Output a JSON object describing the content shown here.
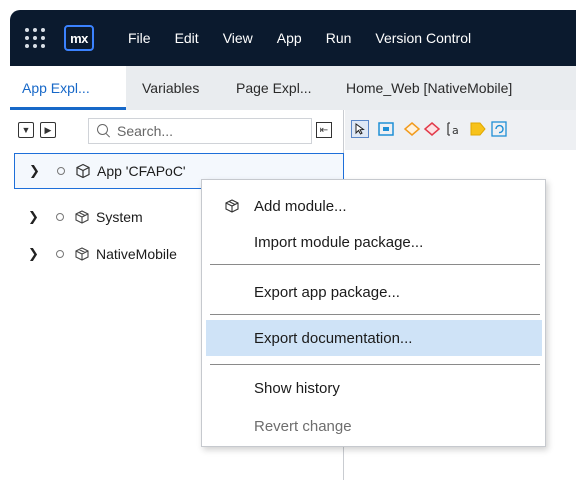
{
  "menubar": {
    "logo": "mx",
    "items": [
      "File",
      "Edit",
      "View",
      "App",
      "Run",
      "Version Control"
    ]
  },
  "tabs": [
    "App Expl...",
    "Variables",
    "Page Expl...",
    "Home_Web [NativeMobile]"
  ],
  "search": {
    "placeholder": "Search..."
  },
  "tree": [
    {
      "label": "App 'CFAPoC'"
    },
    {
      "label": "System"
    },
    {
      "label": "NativeMobile"
    }
  ],
  "context_menu": {
    "items": [
      {
        "label": "Add module...",
        "icon": "module-icon"
      },
      {
        "label": "Import module package..."
      },
      {
        "label": "Export app package..."
      },
      {
        "label": "Export documentation..."
      },
      {
        "label": "Show history"
      },
      {
        "label": "Revert change",
        "disabled": true
      }
    ]
  },
  "colors": {
    "menubar_bg": "#0b1a2e",
    "accent": "#1768c8",
    "hover": "#cfe3f7",
    "toolbar_orange": "#f29b1e",
    "toolbar_red": "#e23b4a",
    "toolbar_yellow": "#f7c21a",
    "toolbar_blue": "#1e8fd6"
  }
}
